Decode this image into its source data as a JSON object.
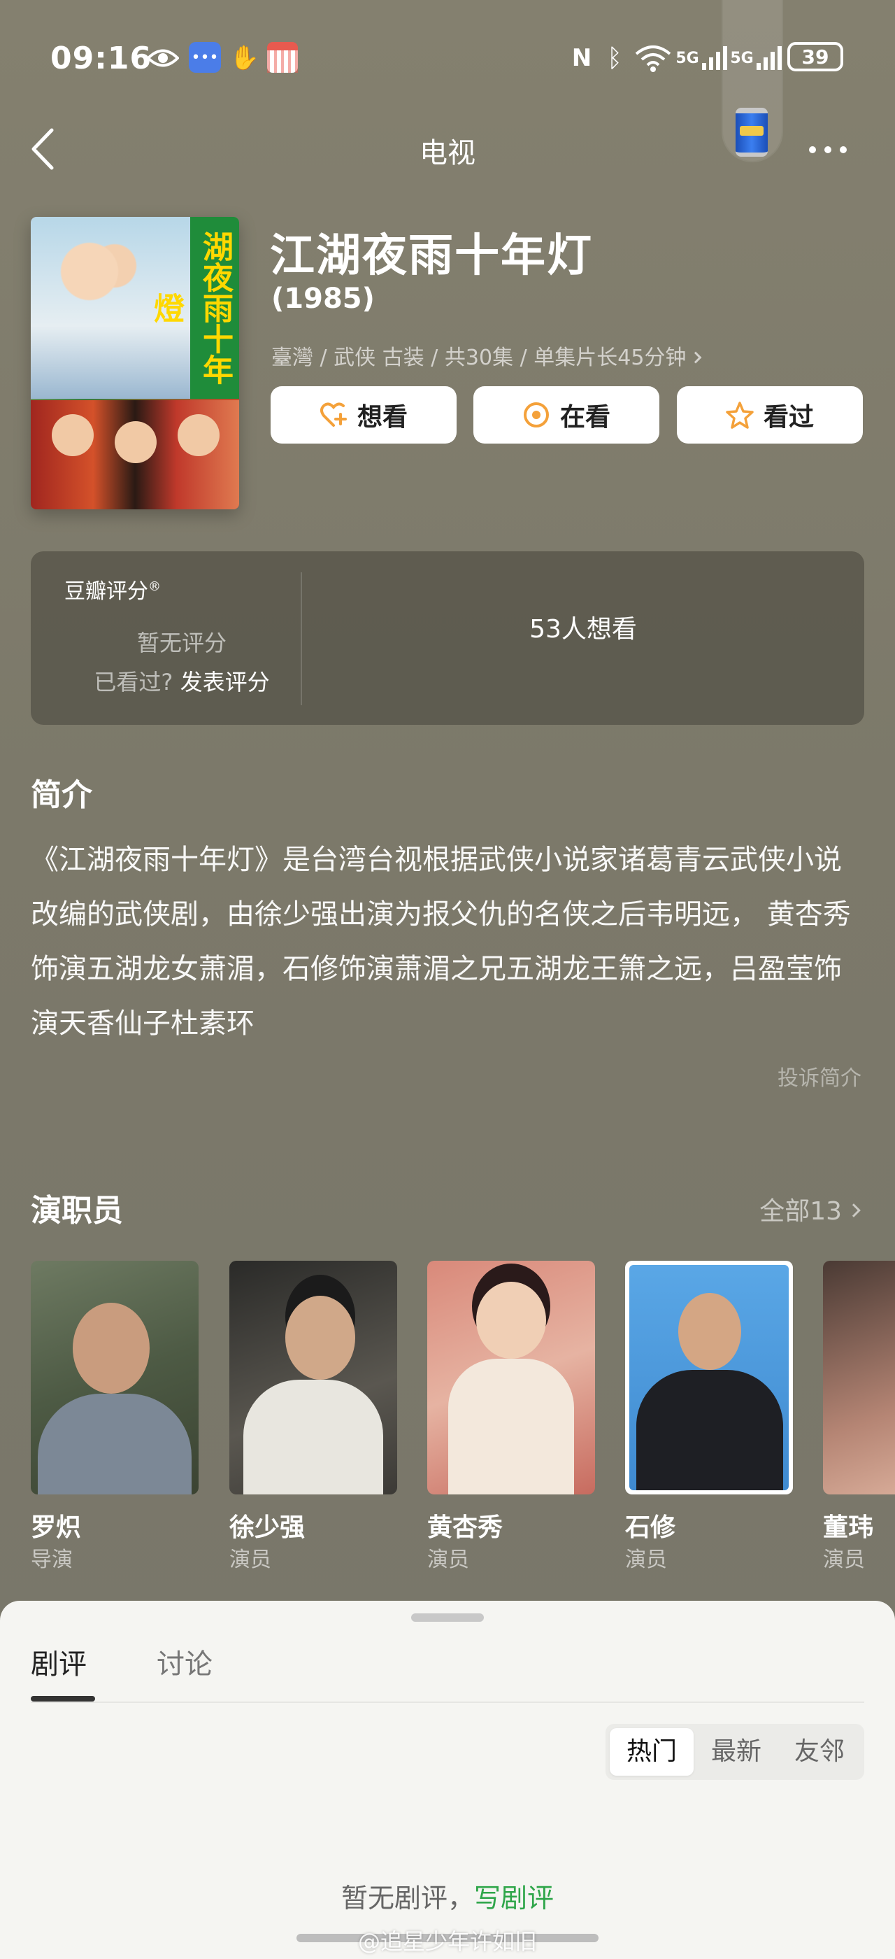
{
  "status_bar": {
    "time": "09:16",
    "signal1_label": "5G",
    "signal2_label": "5G",
    "battery": "39"
  },
  "nav": {
    "title": "电视"
  },
  "show": {
    "poster_text": "湖夜雨十年燈",
    "title": "江湖夜雨十年灯",
    "year": "(1985)",
    "meta": "臺灣 / 武侠 古装 / 共30集 / 单集片长45分钟"
  },
  "actions": {
    "want": "想看",
    "watching": "在看",
    "watched": "看过"
  },
  "rating": {
    "brand": "豆瓣评分",
    "brand_mark": "®",
    "none": "暂无评分",
    "prompt": "已看过?",
    "publish": "发表评分",
    "want_count": "53人想看"
  },
  "intro": {
    "title": "简介",
    "text": "《江湖夜雨十年灯》是台湾台视根据武侠小说家诸葛青云武侠小说改编的武侠剧，由徐少强出演为报父仇的名侠之后韦明远， 黄杏秀饰演五湖龙女萧湄，石修饰演萧湄之兄五湖龙王箫之远，吕盈莹饰演天香仙子杜素环",
    "report": "投诉简介"
  },
  "cast": {
    "title": "演职员",
    "all": "全部13",
    "members": [
      {
        "name": "罗炽",
        "role": "导演"
      },
      {
        "name": "徐少强",
        "role": "演员"
      },
      {
        "name": "黄杏秀",
        "role": "演员"
      },
      {
        "name": "石修",
        "role": "演员"
      },
      {
        "name": "董玮",
        "role": "演员"
      }
    ]
  },
  "sheet": {
    "tabs": [
      "剧评",
      "讨论"
    ],
    "sort_options": [
      "热门",
      "最新",
      "友邻"
    ],
    "empty_text": "暂无剧评，",
    "write_link": "写剧评",
    "watermark": "@追星少年许如旧"
  },
  "colors": {
    "background": "#7d7a6c",
    "accent_orange": "#f4a13a",
    "link_green": "#2fa64a"
  }
}
